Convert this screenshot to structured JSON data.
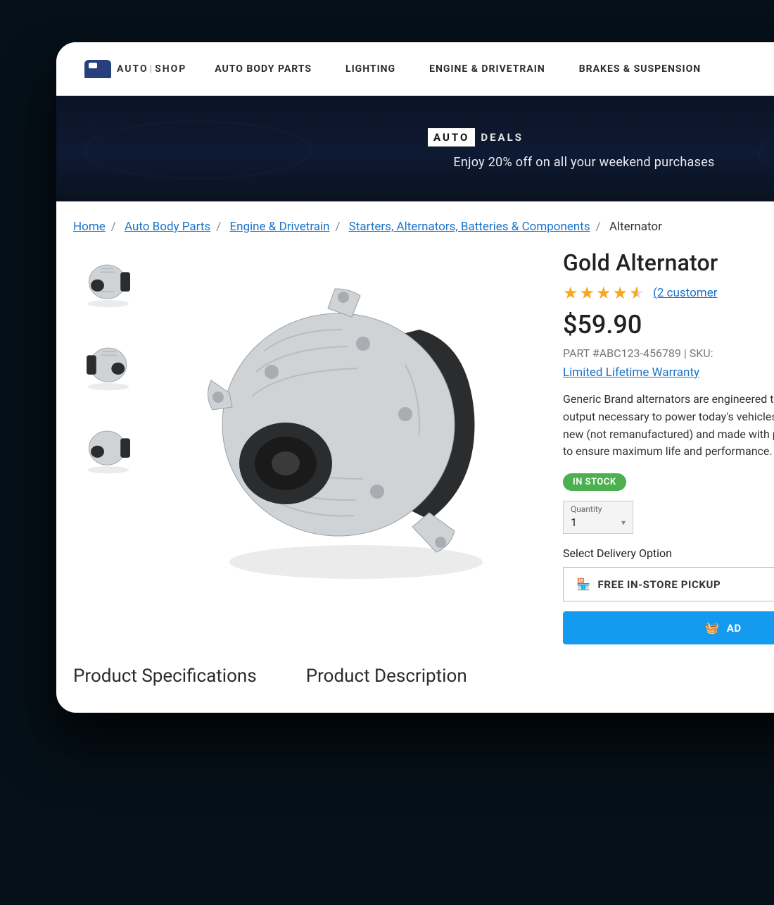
{
  "logo": {
    "pre": "AUTO",
    "sep": "|",
    "post": "SHOP"
  },
  "nav": [
    "AUTO BODY PARTS",
    "LIGHTING",
    "ENGINE & DRIVETRAIN",
    "BRAKES & SUSPENSION"
  ],
  "banner": {
    "badge_a": "AUTO",
    "badge_b": "DEALS",
    "sub": "Enjoy 20% off on all your weekend purchases"
  },
  "crumbs": [
    {
      "label": "Home",
      "link": true
    },
    {
      "label": "Auto Body Parts",
      "link": true
    },
    {
      "label": "Engine & Drivetrain",
      "link": true
    },
    {
      "label": "Starters, Alternators, Batteries & Components",
      "link": true
    },
    {
      "label": "Alternator",
      "link": false
    }
  ],
  "product": {
    "title": "Gold Alternator",
    "rating": 4.5,
    "reviews_text": "(2 customer",
    "price": "$59.90",
    "sku": "PART #ABC123-456789 | SKU:",
    "warranty": "Limited Lifetime Warranty",
    "desc": "Generic Brand alternators are engineered to provide the amp output necessary to power today's vehicles. Every unit is 100% new (not remanufactured) and made with premium components to ensure maximum life and performance.",
    "stock": "IN STOCK",
    "qty_label": "Quantity",
    "qty_value": "1",
    "delivery_label": "Select Delivery Option",
    "pickup": "FREE IN-STORE PICKUP",
    "cart": "AD"
  },
  "tabs": [
    "Product Specifications",
    "Product Description"
  ]
}
